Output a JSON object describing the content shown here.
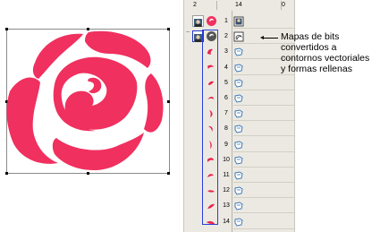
{
  "panel": {
    "header": {
      "col_a": "2",
      "col_b": "14",
      "col_c": "0"
    },
    "rows": [
      {
        "num": "1"
      },
      {
        "num": "2"
      },
      {
        "num": "3"
      },
      {
        "num": "4"
      },
      {
        "num": "5"
      },
      {
        "num": "6"
      },
      {
        "num": "7"
      },
      {
        "num": "8"
      },
      {
        "num": "9"
      },
      {
        "num": "10"
      },
      {
        "num": "11"
      },
      {
        "num": "12"
      },
      {
        "num": "13"
      },
      {
        "num": "14"
      }
    ],
    "expander": "−"
  },
  "annotation": {
    "lines": [
      "Mapas de bits",
      "convertidos a",
      "contornos vectoriales",
      "y formas rellenas"
    ]
  },
  "colors": {
    "rose": "#f0305f",
    "selection": "#2a3fd6"
  },
  "icons": {
    "bitmap": "bitmap-icon",
    "vector_shape": "vector-shape-icon",
    "fill_object": "fill-object-icon"
  }
}
